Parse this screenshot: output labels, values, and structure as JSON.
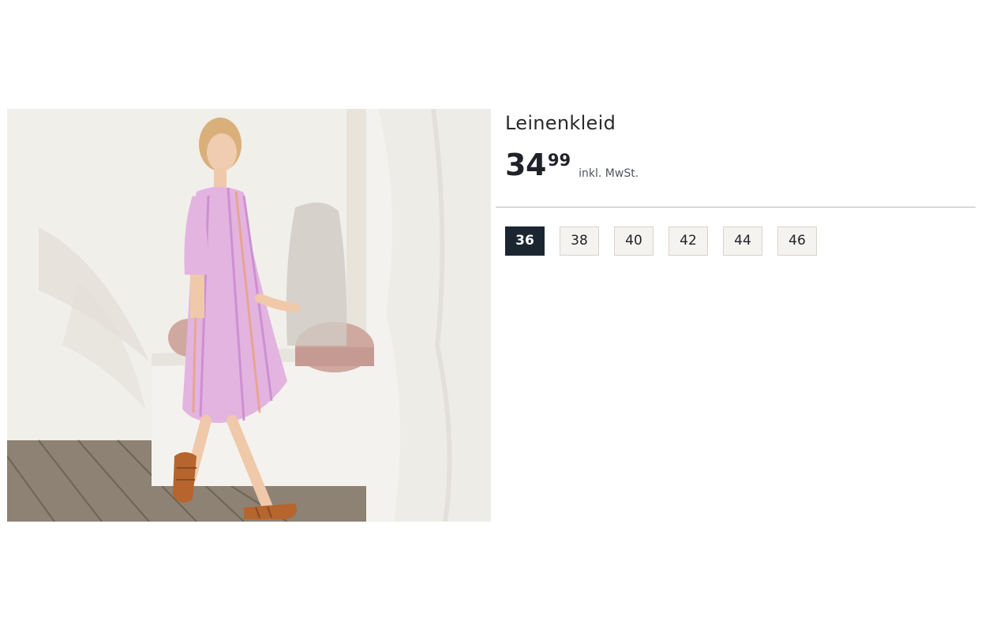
{
  "product": {
    "image_alt": "Frau in rosa gestreiftem Leinenkleid",
    "title": "Leinenkleid",
    "price_main": "34",
    "price_cents": "99",
    "price_note": "inkl. MwSt."
  },
  "sizes": {
    "selected": "36",
    "options": [
      "36",
      "38",
      "40",
      "42",
      "44",
      "46"
    ]
  },
  "colors": {
    "selected_bg": "#1b2630",
    "option_bg": "#f5f3ef",
    "dress": "#e3b4e0"
  }
}
